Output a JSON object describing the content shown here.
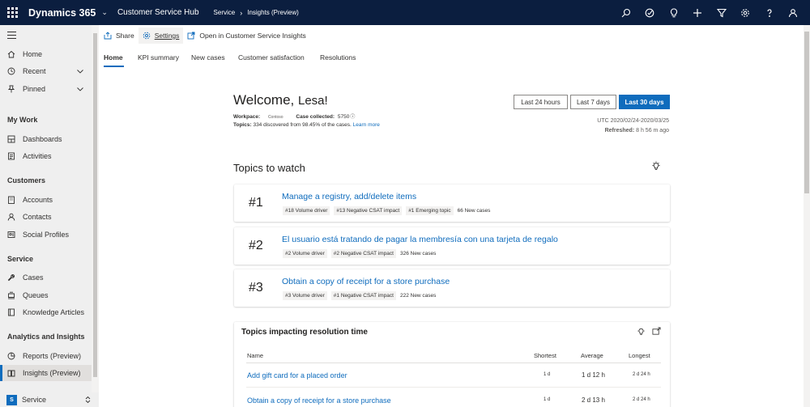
{
  "topbar": {
    "brand": "Dynamics 365",
    "app_name": "Customer Service Hub",
    "breadcrumb": [
      "Service",
      "Insights (Preview)"
    ],
    "icons": [
      "search-icon",
      "task-check-icon",
      "lightbulb-icon",
      "plus-icon",
      "filter-icon",
      "gear-icon",
      "help-icon",
      "user-icon"
    ]
  },
  "sidebar": {
    "items_top": [
      {
        "label": "Home",
        "icon": "home-icon"
      },
      {
        "label": "Recent",
        "icon": "clock-icon"
      },
      {
        "label": "Pinned",
        "icon": "pin-icon"
      }
    ],
    "groups": [
      {
        "title": "My Work",
        "items": [
          "Dashboards",
          "Activities"
        ]
      },
      {
        "title": "Customers",
        "items": [
          "Accounts",
          "Contacts",
          "Social Profiles"
        ]
      },
      {
        "title": "Service",
        "items": [
          "Cases",
          "Queues",
          "Knowledge Articles"
        ]
      },
      {
        "title": "Analytics and Insights",
        "items": [
          "Reports (Preview)",
          "Insights (Preview)"
        ]
      }
    ],
    "area": {
      "badge": "S",
      "label": "Service"
    }
  },
  "toolbar": {
    "share": "Share",
    "settings": "Settings",
    "open": "Open in Customer Service Insights"
  },
  "tabs": [
    "Home",
    "KPI summary",
    "New cases",
    "Customer satisfaction",
    "Resolutions"
  ],
  "welcome": {
    "greeting": "Welcome,",
    "name": "Lesa!",
    "workpace_label": "Workpace:",
    "workpace_value": "Contoso",
    "cases_label": "Case collected:",
    "cases_value": "5750",
    "topics_label": "Topics:",
    "topics_text": "334 discovered from 98.45% of the cases.",
    "learn_more": "Learn more"
  },
  "range": {
    "buttons": [
      "Last 24 hours",
      "Last 7 days",
      "Last 30 days"
    ],
    "selected": "Last 30 days",
    "utc": "UTC 2020/02/24-2020/03/25",
    "refreshed_label": "Refreshed:",
    "refreshed_value": "8 h 56 m ago"
  },
  "topics_to_watch": {
    "title": "Topics to watch",
    "items": [
      {
        "rank": "#1",
        "title": "Manage a registry, add/delete items",
        "tags": [
          "#18 Volume driver",
          "#13 Negative CSAT impact",
          "#1 Emerging topic"
        ],
        "new_cases": "66 New cases"
      },
      {
        "rank": "#2",
        "title": "El usuario está tratando de pagar la membresía con una tarjeta de regalo",
        "tags": [
          "#2 Volume driver",
          "#2 Negative CSAT impact"
        ],
        "new_cases": "326 New cases"
      },
      {
        "rank": "#3",
        "title": "Obtain a copy of receipt for a store purchase",
        "tags": [
          "#3 Volume driver",
          "#1 Negative CSAT impact"
        ],
        "new_cases": "222 New cases"
      }
    ]
  },
  "resolution": {
    "title": "Topics impacting resolution time",
    "columns": [
      "Name",
      "Shortest",
      "Average",
      "Longest"
    ],
    "rows": [
      {
        "name": "Add gift card for a placed order",
        "shortest": "1 d",
        "average": "1 d 12 h",
        "longest": "2 d 24 h"
      },
      {
        "name": "Obtain a copy of receipt for a store purchase",
        "shortest": "1 d",
        "average": "2 d 13 h",
        "longest": "2 d 24 h"
      }
    ]
  },
  "colors": {
    "topbar": "#0b1e3f",
    "accent": "#0f6cbd",
    "sidebar": "#efefef"
  }
}
